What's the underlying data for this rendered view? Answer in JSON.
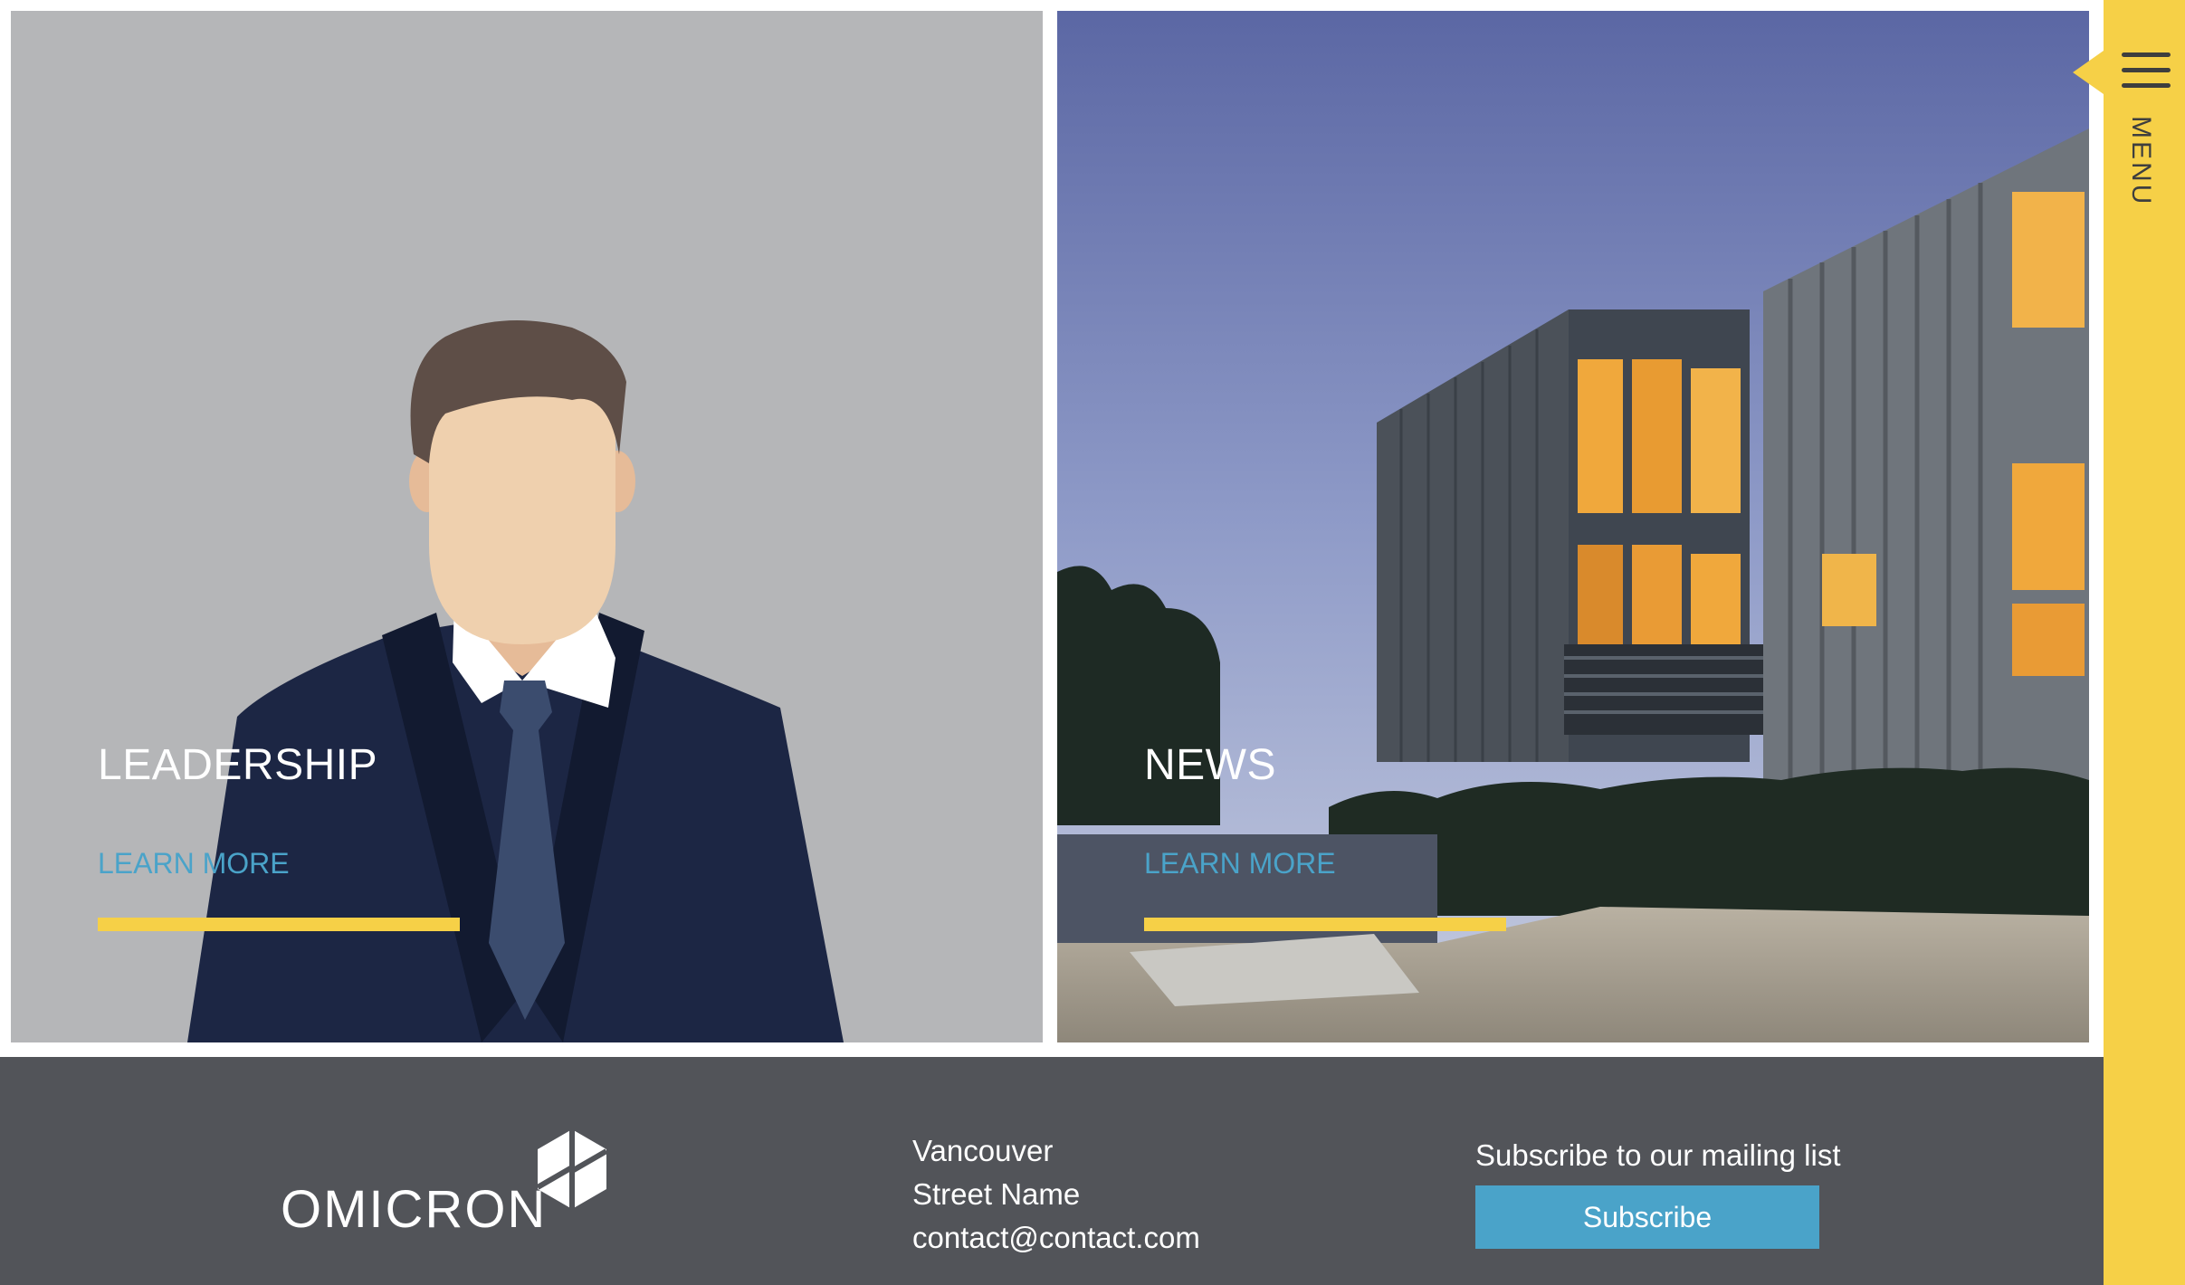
{
  "tiles": [
    {
      "title": "LEADERSHIP",
      "link": "LEARN MORE"
    },
    {
      "title": "NEWS",
      "link": "LEARN MORE"
    }
  ],
  "footer": {
    "brand": "OMICRON",
    "contact": {
      "city": "Vancouver",
      "street": "Street Name",
      "email": "contact@contact.com"
    },
    "subscribe": {
      "label": "Subscribe to our mailing list",
      "button": "Subscribe"
    }
  },
  "menu": {
    "label": "MENU",
    "icon": "hamburger-icon"
  },
  "colors": {
    "accent": "#f6d047",
    "link": "#4aa3c9",
    "footer_bg": "#525459",
    "leadership_bg": "#b5b6b8"
  }
}
